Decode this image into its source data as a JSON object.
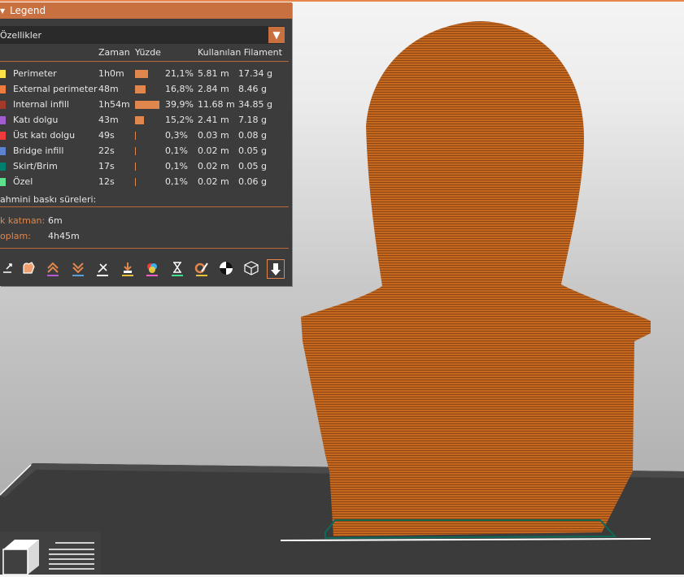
{
  "legend": {
    "title": "Legend",
    "view_type": "Özellikler",
    "columns": {
      "time": "Zaman",
      "percent": "Yüzde",
      "used": "Kullanılan Filament"
    },
    "rows": [
      {
        "name": "Perimeter",
        "color": "#ffe24a",
        "time": "1h0m",
        "percent": "21,1%",
        "percent_value": 0.211,
        "length": "5.81 m",
        "weight": "17.34 g"
      },
      {
        "name": "External perimeter",
        "color": "#ef7c3f",
        "time": "48m",
        "percent": "16,8%",
        "percent_value": 0.168,
        "length": "2.84 m",
        "weight": "8.46 g"
      },
      {
        "name": "Internal infill",
        "color": "#a33a2b",
        "time": "1h54m",
        "percent": "39,9%",
        "percent_value": 0.399,
        "length": "11.68 m",
        "weight": "34.85 g"
      },
      {
        "name": "Katı dolgu",
        "color": "#a35ccf",
        "time": "43m",
        "percent": "15,2%",
        "percent_value": 0.152,
        "length": "2.41 m",
        "weight": "7.18 g"
      },
      {
        "name": "Üst katı dolgu",
        "color": "#ef3b3b",
        "time": "49s",
        "percent": "0,3%",
        "percent_value": 0.003,
        "length": "0.03 m",
        "weight": "0.08 g"
      },
      {
        "name": "Bridge infill",
        "color": "#5c83cf",
        "time": "22s",
        "percent": "0,1%",
        "percent_value": 0.001,
        "length": "0.02 m",
        "weight": "0.05 g"
      },
      {
        "name": "Skirt/Brim",
        "color": "#00806e",
        "time": "17s",
        "percent": "0,1%",
        "percent_value": 0.001,
        "length": "0.02 m",
        "weight": "0.05 g"
      },
      {
        "name": "Özel",
        "color": "#5ee08f",
        "time": "12s",
        "percent": "0,1%",
        "percent_value": 0.001,
        "length": "0.02 m",
        "weight": "0.06 g"
      }
    ],
    "estimate_title": "ahmini baskı süreleri:",
    "first_layer_label": "k katman:",
    "first_layer_value": "6m",
    "total_label": "oplam:",
    "total_value": "4h45m"
  },
  "toolbar_icons": [
    "travel-icon",
    "wipe-icon",
    "retractions-icon",
    "deretractions-icon",
    "seams-icon",
    "tool-changes-icon",
    "color-changes-icon",
    "pause-icon",
    "custom-gcode-icon",
    "center-of-gravity-icon",
    "shells-icon",
    "tool-marker-icon"
  ],
  "colors": {
    "accent": "#c8703f",
    "model": "#c0651f",
    "panel": "#3c3c3c"
  }
}
